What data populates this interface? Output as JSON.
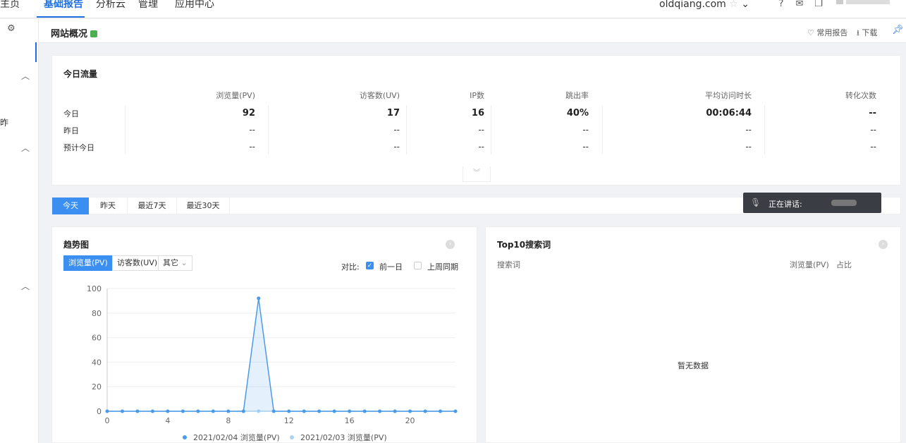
{
  "topnav": {
    "items": [
      "主页",
      "基础报告",
      "分析云",
      "管理",
      "应用中心"
    ],
    "active": "基础报告",
    "site": "oldqiang.com"
  },
  "leftrail": {
    "label": "昨"
  },
  "titlebar": {
    "title": "网站概况",
    "common_report": "常用报告",
    "download": "下载"
  },
  "traffic": {
    "title": "今日流量",
    "columns": [
      "浏览量(PV)",
      "访客数(UV)",
      "IP数",
      "跳出率",
      "平均访问时长",
      "转化次数"
    ],
    "rows": [
      {
        "label": "今日",
        "values": [
          "92",
          "17",
          "16",
          "40%",
          "00:06:44",
          "--"
        ]
      },
      {
        "label": "昨日",
        "values": [
          "--",
          "--",
          "--",
          "--",
          "--",
          "--"
        ]
      },
      {
        "label": "预计今日",
        "values": [
          "--",
          "--",
          "--",
          "--",
          "--",
          "--"
        ]
      }
    ]
  },
  "range_tabs": [
    "今天",
    "昨天",
    "最近7天",
    "最近30天"
  ],
  "speaking": {
    "label": "正在讲话:"
  },
  "trend": {
    "title": "趋势图",
    "metrics": [
      "浏览量(PV)",
      "访客数(UV)",
      "其它"
    ],
    "compare_label": "对比:",
    "compare_options": [
      "前一日",
      "上周同期"
    ],
    "legend": [
      "2021/02/04 浏览量(PV)",
      "2021/02/03 浏览量(PV)"
    ]
  },
  "top10": {
    "title": "Top10搜索词",
    "col_keyword": "搜索词",
    "col_pv": "浏览量(PV)",
    "col_ratio": "占比",
    "empty": "暂无数据"
  },
  "colors": {
    "accent": "#3b8ff0",
    "series_today": "#4a9be8",
    "series_prev": "#a9d3f5"
  },
  "chart_data": {
    "type": "line",
    "x": [
      0,
      1,
      2,
      3,
      4,
      5,
      6,
      7,
      8,
      9,
      10,
      11,
      12,
      13,
      14,
      15,
      16,
      17,
      18,
      19,
      20,
      21,
      22,
      23
    ],
    "xticks": [
      0,
      4,
      8,
      12,
      16,
      20
    ],
    "yticks": [
      0,
      20,
      40,
      60,
      80,
      100
    ],
    "ylim": [
      0,
      100
    ],
    "series": [
      {
        "name": "2021/02/04 浏览量(PV)",
        "values": [
          0,
          0,
          0,
          0,
          0,
          0,
          0,
          0,
          0,
          0,
          92,
          0,
          0,
          0,
          0,
          0,
          0,
          0,
          0,
          0,
          0,
          0,
          0,
          0
        ]
      },
      {
        "name": "2021/02/03 浏览量(PV)",
        "values": [
          0,
          0,
          0,
          0,
          0,
          0,
          0,
          0,
          0,
          0,
          0,
          0,
          0,
          0,
          0,
          0,
          0,
          0,
          0,
          0,
          0,
          0,
          0,
          0
        ]
      }
    ]
  }
}
